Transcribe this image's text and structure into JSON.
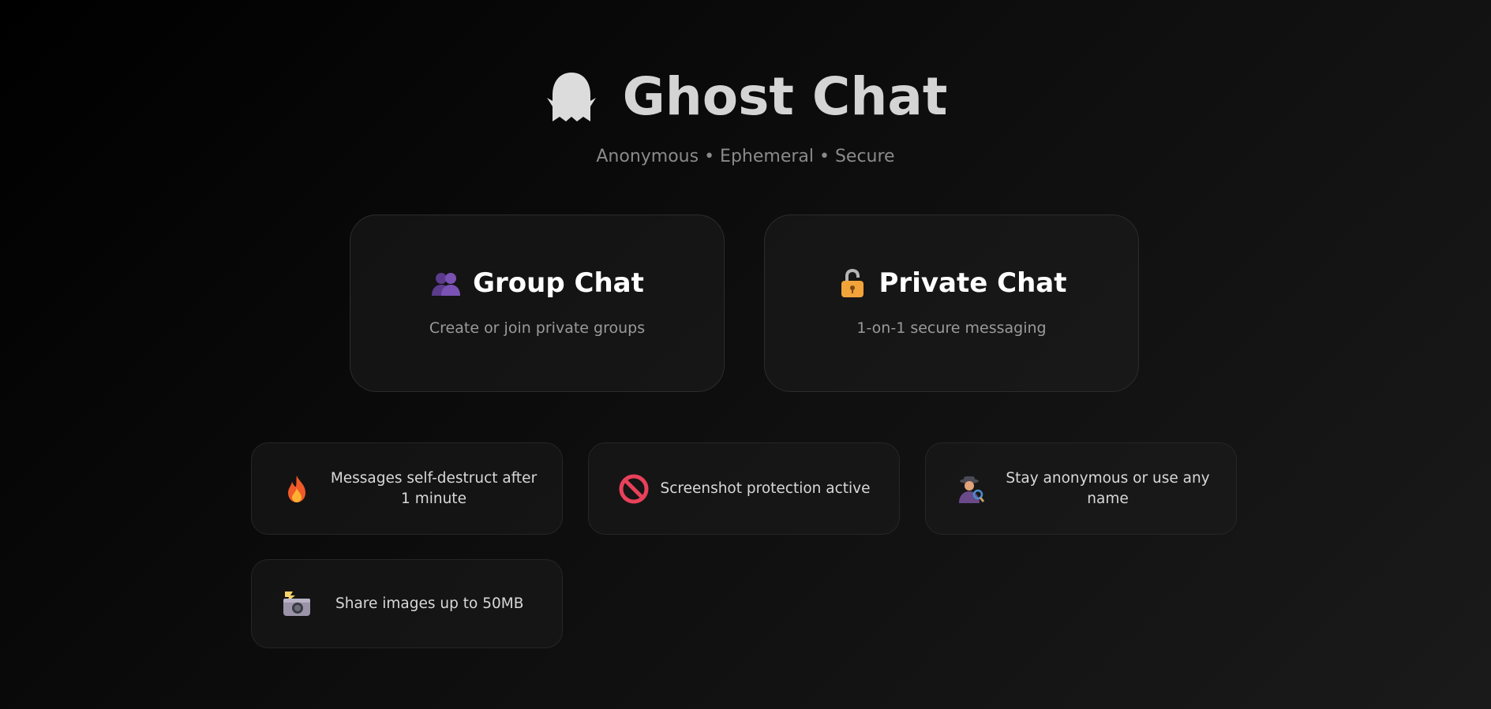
{
  "app": {
    "title": "Ghost Chat",
    "subtitle": "Anonymous • Ephemeral • Secure",
    "icon": "ghost-icon"
  },
  "modes": [
    {
      "icon": "people-icon",
      "title": "Group Chat",
      "description": "Create or join private groups"
    },
    {
      "icon": "lock-icon",
      "title": "Private Chat",
      "description": "1-on-1 secure messaging"
    }
  ],
  "features": [
    {
      "icon": "fire-icon",
      "text": "Messages self-destruct after 1 minute"
    },
    {
      "icon": "no-entry-icon",
      "text": "Screenshot protection active"
    },
    {
      "icon": "detective-icon",
      "text": "Stay anonymous or use any name"
    },
    {
      "icon": "camera-flash-icon",
      "text": "Share images up to 50MB"
    }
  ],
  "colors": {
    "background": "#000000",
    "title": "#d4d4d4",
    "subtitle": "#8a8a8a",
    "card_title": "#ffffff"
  }
}
